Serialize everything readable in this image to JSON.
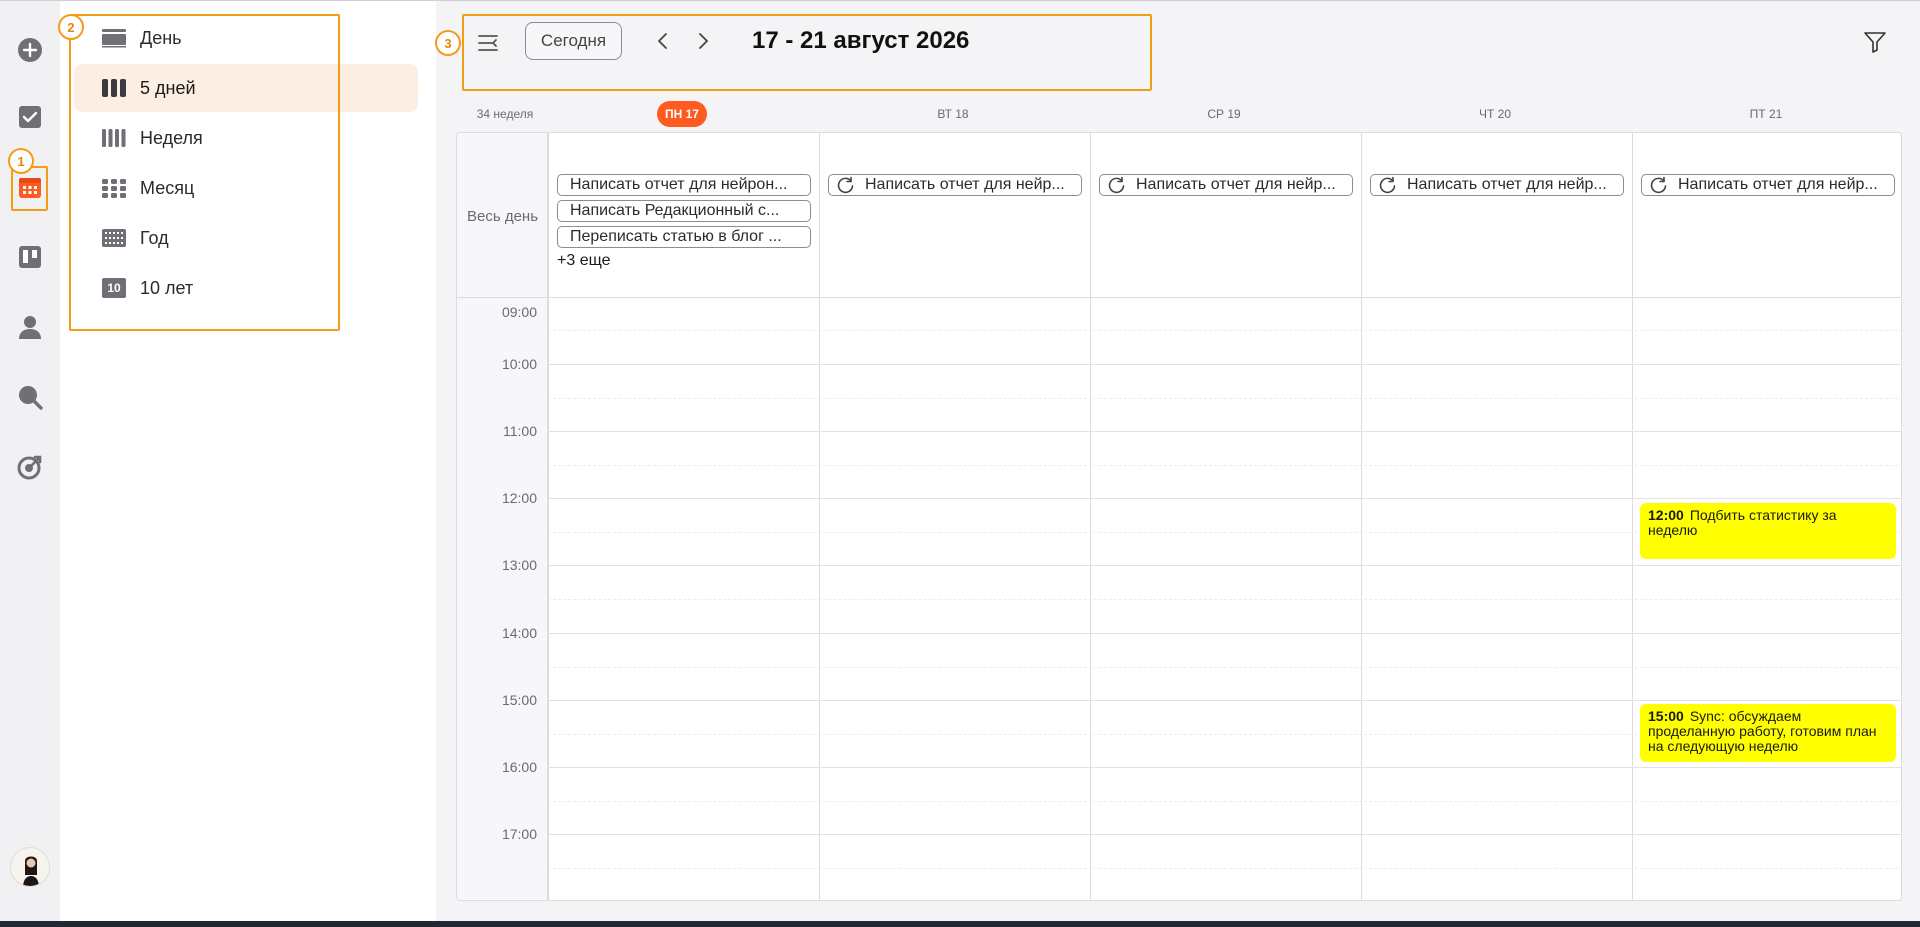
{
  "colors": {
    "accent": "#ff5a1f",
    "annotation": "#f59b1a",
    "event_yellow": "#ffff00",
    "active_menu_bg": "#fdeee3"
  },
  "rail": {
    "icons": [
      "plus-circle-icon",
      "checkbox-icon",
      "calendar-icon",
      "kanban-board-icon",
      "person-icon",
      "search-icon",
      "target-icon"
    ]
  },
  "view_menu": {
    "items": [
      {
        "label": "День",
        "icon": "day-view-icon",
        "active": false
      },
      {
        "label": "5 дней",
        "icon": "five-day-view-icon",
        "active": true
      },
      {
        "label": "Неделя",
        "icon": "week-view-icon",
        "active": false
      },
      {
        "label": "Месяц",
        "icon": "month-view-icon",
        "active": false
      },
      {
        "label": "Год",
        "icon": "year-view-icon",
        "active": false
      },
      {
        "label": "10 лет",
        "icon": "ten-years-icon",
        "icon_text": "10",
        "active": false
      }
    ]
  },
  "toolbar": {
    "today_label": "Сегодня",
    "range_title": "17 - 21 август 2026"
  },
  "calendar": {
    "week_label": "34 неделя",
    "days": [
      {
        "label": "ПН 17",
        "today": true
      },
      {
        "label": "ВТ 18",
        "today": false
      },
      {
        "label": "СР 19",
        "today": false
      },
      {
        "label": "ЧТ 20",
        "today": false
      },
      {
        "label": "ПТ 21",
        "today": false
      }
    ],
    "all_day_label": "Весь день",
    "all_day_events": {
      "mon": [
        "Написать отчет для нейрон...",
        "Написать Редакционный с...",
        "Переписать статью в блог ..."
      ],
      "mon_more": "+3 еще",
      "recurring": [
        "Написать отчет для нейр...",
        "Написать отчет для нейр...",
        "Написать отчет для нейр...",
        "Написать отчет для нейр..."
      ]
    },
    "hours": [
      "09:00",
      "10:00",
      "11:00",
      "12:00",
      "13:00",
      "14:00",
      "15:00",
      "16:00",
      "17:00"
    ],
    "events": [
      {
        "time": "12:00",
        "title": "Подбить статистику за неделю"
      },
      {
        "time": "15:00",
        "title": "Sync: обсуждаем проделанную работу, готовим план на следующую неделю"
      }
    ]
  },
  "annotations": [
    "1",
    "2",
    "3"
  ]
}
